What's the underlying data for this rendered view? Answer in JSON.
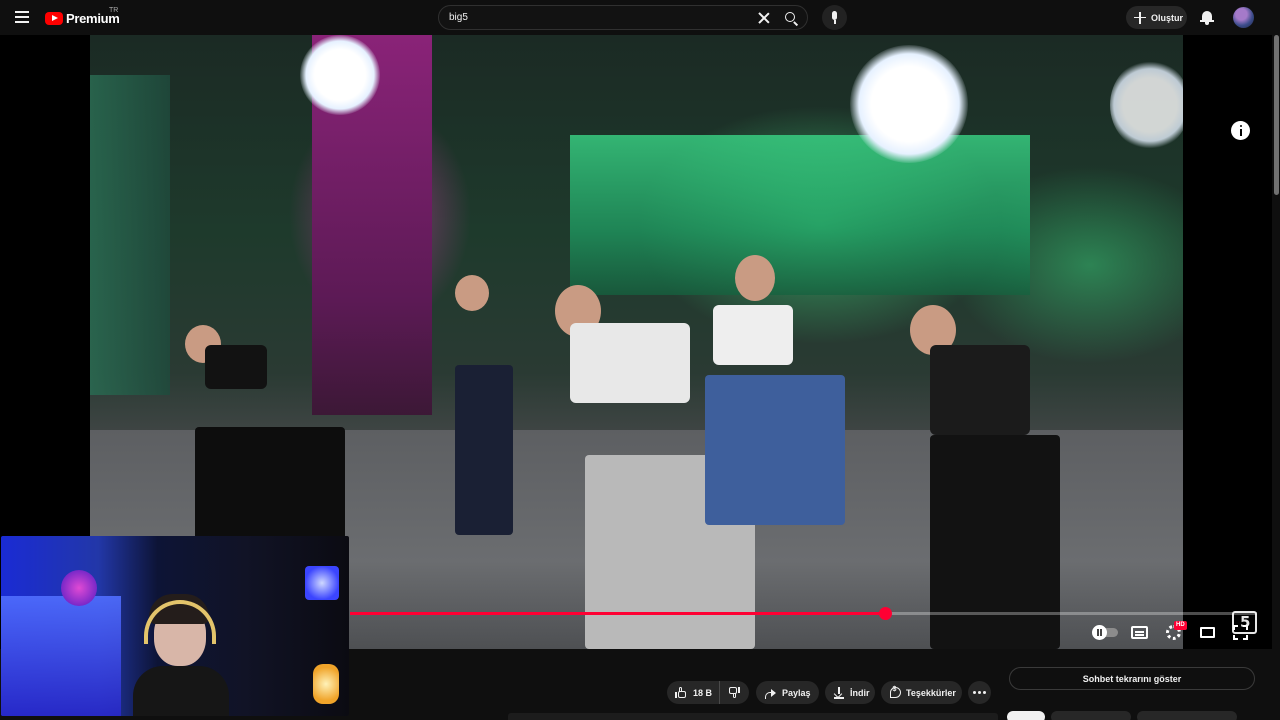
{
  "header": {
    "logo_text": "Premium",
    "country_code": "TR",
    "search_value": "big5",
    "create_label": "Oluştur"
  },
  "player": {
    "progress_fraction": 0.59,
    "autoplay": "paused",
    "hd_badge": "HD"
  },
  "actions": {
    "like_count": "18 B",
    "share_label": "Paylaş",
    "download_label": "İndir",
    "thanks_label": "Teşekkürler"
  },
  "sidebar": {
    "chat_toggle_label": "Sohbet tekrarını göster"
  },
  "colors": {
    "background": "#0f0f0f",
    "accent": "#ff0033",
    "brand": "#ff0000",
    "pill": "#272727"
  },
  "icons": [
    "menu-icon",
    "youtube-logo-icon",
    "clear-icon",
    "search-icon",
    "mic-icon",
    "plus-icon",
    "bell-icon",
    "info-icon",
    "autoplay-toggle-icon",
    "subtitles-icon",
    "settings-icon",
    "theater-icon",
    "fullscreen-icon",
    "like-icon",
    "dislike-icon",
    "share-icon",
    "download-icon",
    "thanks-icon",
    "more-icon"
  ]
}
